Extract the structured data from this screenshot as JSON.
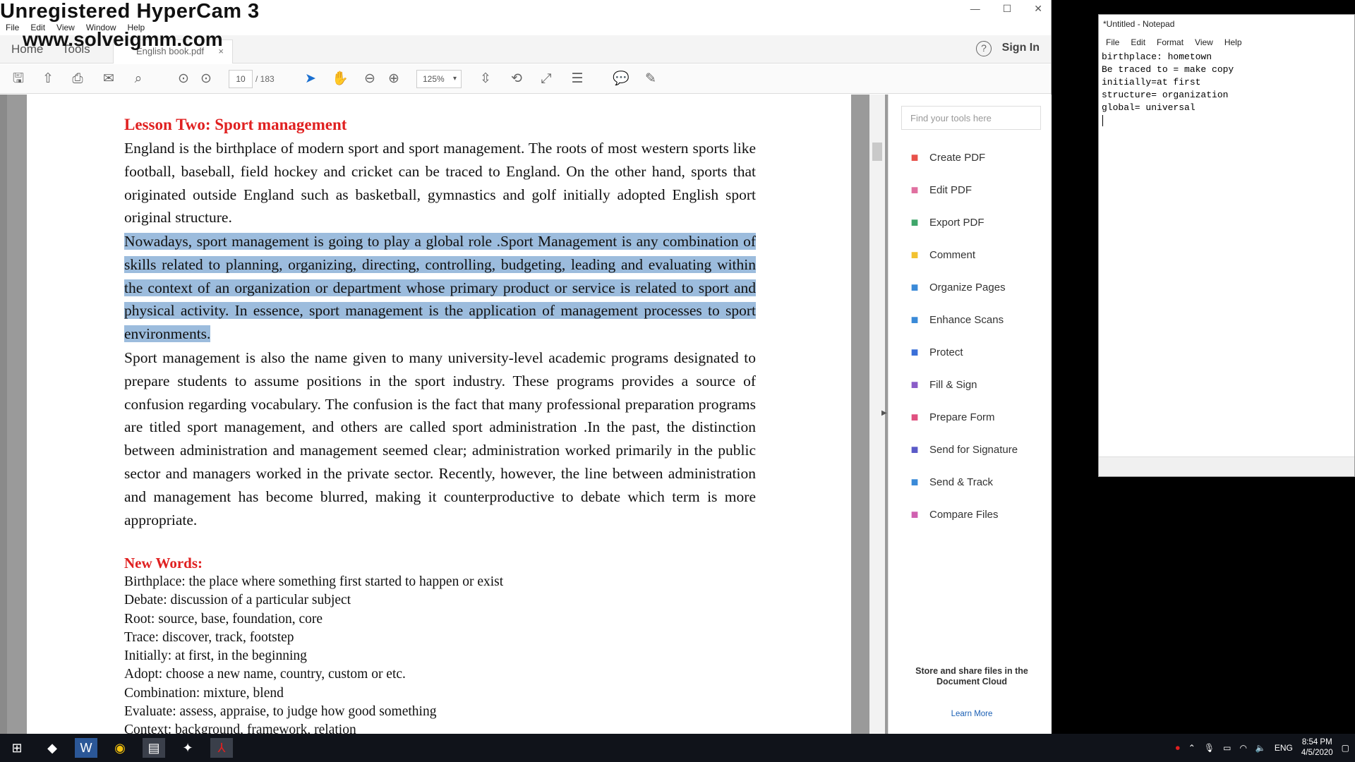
{
  "watermark": {
    "line1": "Unregistered HyperCam 3",
    "line2": "www.solveigmm.com"
  },
  "menubar": [
    "File",
    "Edit",
    "View",
    "Window",
    "Help"
  ],
  "window_controls": [
    "—",
    "☐",
    "✕"
  ],
  "tabs": {
    "home": "Home",
    "tools": "Tools",
    "doc": "English book.pdf",
    "close": "×"
  },
  "header": {
    "help": "?",
    "signin": "Sign In"
  },
  "toolbar": {
    "page_current": "10",
    "page_total": "/ 183",
    "zoom": "125%"
  },
  "document": {
    "lesson_title": "Lesson Two: Sport management",
    "p1": "England is the birthplace of modern sport and sport management. The roots of most western sports like football, baseball, field hockey and cricket can be traced to England. On the other hand, sports that originated outside England such as basketball, gymnastics and golf initially adopted English sport original structure.",
    "p2": "Nowadays, sport management is going to play a global role .Sport Management is any combination of skills related to planning, organizing, directing, controlling, budgeting, leading and evaluating within the context of an organization or department whose primary product or service is related to sport and physical activity. In essence, sport management is the application of management processes to sport environments.",
    "p3": "Sport management is also the name given to many university-level academic programs designated to prepare students to assume positions in the sport industry. These programs provides a source of confusion regarding vocabulary. The confusion is the fact that many professional preparation programs are titled sport management, and others are called sport administration .In the past, the distinction between administration and management seemed clear; administration worked primarily in the public sector and managers worked in the private sector. Recently, however, the line between administration and management has become blurred, making it counterproductive to debate which term is more appropriate.",
    "new_words_title": "New Words:",
    "words": [
      "Birthplace: the place where something first started to happen or exist",
      "Debate: discussion of a particular subject",
      "Root: source, base, foundation, core",
      "Trace: discover, track, footstep",
      "Initially: at first, in the beginning",
      "Adopt: choose a new name, country, custom or etc.",
      "Combination: mixture, blend",
      "Evaluate: assess, appraise, to judge how good something",
      "Context: background, framework, relation"
    ]
  },
  "tools_panel": {
    "search_placeholder": "Find your tools here",
    "items": [
      {
        "label": "Create PDF",
        "icon": "create-pdf-icon",
        "color": "#e8514a"
      },
      {
        "label": "Edit PDF",
        "icon": "edit-pdf-icon",
        "color": "#e070a0"
      },
      {
        "label": "Export PDF",
        "icon": "export-pdf-icon",
        "color": "#3fa66a"
      },
      {
        "label": "Comment",
        "icon": "comment-icon",
        "color": "#f2c230"
      },
      {
        "label": "Organize Pages",
        "icon": "organize-pages-icon",
        "color": "#3a8ad8"
      },
      {
        "label": "Enhance Scans",
        "icon": "enhance-scans-icon",
        "color": "#3a8ad8"
      },
      {
        "label": "Protect",
        "icon": "protect-icon",
        "color": "#3a6fd8"
      },
      {
        "label": "Fill & Sign",
        "icon": "fill-sign-icon",
        "color": "#8a5cc8"
      },
      {
        "label": "Prepare Form",
        "icon": "prepare-form-icon",
        "color": "#e05080"
      },
      {
        "label": "Send for Signature",
        "icon": "send-signature-icon",
        "color": "#5a5ac8"
      },
      {
        "label": "Send & Track",
        "icon": "send-track-icon",
        "color": "#3a8ad8"
      },
      {
        "label": "Compare Files",
        "icon": "compare-files-icon",
        "color": "#d060b0"
      }
    ],
    "cloud_text": "Store and share files in the Document Cloud",
    "learn_more": "Learn More"
  },
  "notepad": {
    "title": "*Untitled - Notepad",
    "menu": [
      "File",
      "Edit",
      "Format",
      "View",
      "Help"
    ],
    "text": "birthplace: hometown\nBe traced to = make copy\ninitially=at first\nstructure= organization\nglobal= universal"
  },
  "taskbar": {
    "lang": "ENG",
    "time": "8:54 PM",
    "date": "4/5/2020"
  }
}
